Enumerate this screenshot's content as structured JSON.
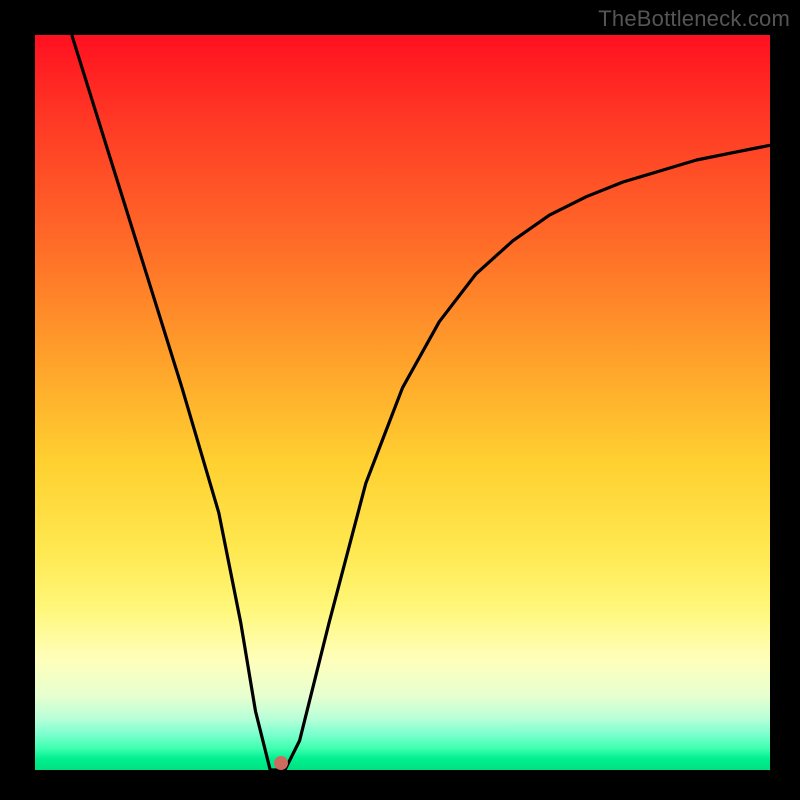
{
  "watermark": "TheBottleneck.com",
  "gradient_colors": {
    "top": "#ff1020",
    "mid_orange": "#ff9a2a",
    "yellow": "#ffe850",
    "pale": "#ffffbb",
    "green": "#00e080"
  },
  "dot": {
    "x_percent_of_plot": 33.5,
    "y_percent_of_plot": 99.0,
    "color": "#cc6b5f"
  },
  "chart_data": {
    "type": "line",
    "title": "",
    "xlabel": "",
    "ylabel": "",
    "xlim": [
      0,
      100
    ],
    "ylim": [
      0,
      100
    ],
    "grid": false,
    "legend": null,
    "series": [
      {
        "name": "bottleneck-curve",
        "color": "#000000",
        "x": [
          5,
          10,
          15,
          20,
          25,
          28,
          30,
          32,
          34,
          36,
          40,
          45,
          50,
          55,
          60,
          65,
          70,
          75,
          80,
          85,
          90,
          95,
          100
        ],
        "y": [
          100,
          84,
          68,
          52,
          35,
          20,
          8,
          0,
          0,
          4,
          20,
          39,
          52,
          61,
          67.5,
          72,
          75.5,
          78,
          80,
          81.5,
          83,
          84,
          85
        ]
      }
    ],
    "marker": {
      "x": 33,
      "y": 0,
      "color": "#cc6b5f"
    },
    "note": "x and y are percent of plot-area width/height; y measured from bottom (0) to top (100). Values estimated from unlabeled axes."
  }
}
